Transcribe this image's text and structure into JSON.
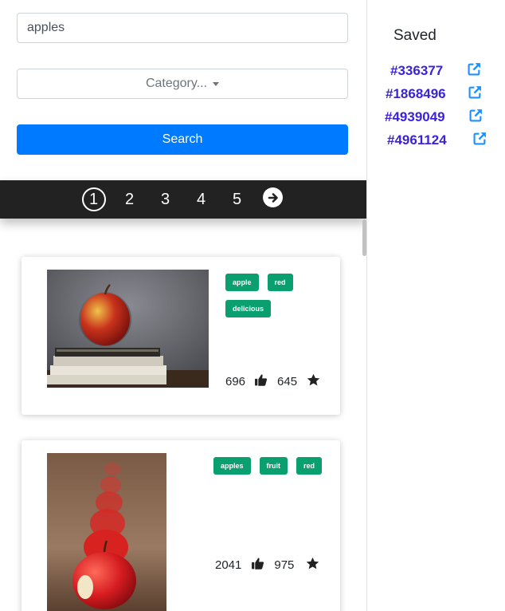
{
  "search": {
    "value": "apples",
    "button_label": "Search"
  },
  "category": {
    "label": "Category..."
  },
  "pagination": {
    "pages": [
      "1",
      "2",
      "3",
      "4",
      "5"
    ],
    "current": "1"
  },
  "results": [
    {
      "tags": [
        "apple",
        "red",
        "delicious"
      ],
      "likes": "696",
      "favorites": "645"
    },
    {
      "tags": [
        "apples",
        "fruit",
        "red"
      ],
      "likes": "2041",
      "favorites": "975"
    }
  ],
  "saved": {
    "title": "Saved",
    "items": [
      "#336377",
      "#1868496",
      "#4939049",
      "#4961124"
    ]
  },
  "colors": {
    "primary": "#007bff",
    "tag": "#0a9f6e",
    "saved_link": "#3a23d9",
    "external_icon": "#1e90ff",
    "pagebar": "#222222"
  }
}
